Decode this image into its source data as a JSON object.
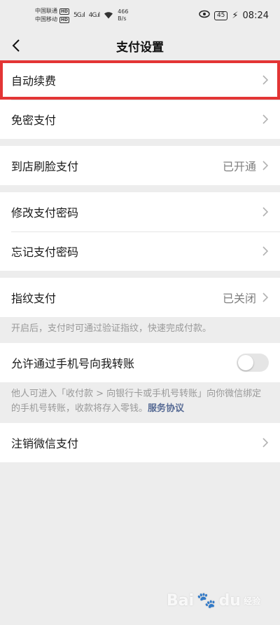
{
  "status_bar": {
    "carrier1": "中国联通",
    "carrier2": "中国移动",
    "hd": "HD",
    "net1": "5G",
    "net2": "4G",
    "speed_value": "466",
    "speed_unit": "B/s",
    "battery": "45",
    "time": "08:24"
  },
  "nav": {
    "title": "支付设置"
  },
  "cells": {
    "auto_renew": "自动续费",
    "password_free": "免密支付",
    "face_pay": {
      "label": "到店刷脸支付",
      "value": "已开通"
    },
    "change_password": "修改支付密码",
    "forgot_password": "忘记支付密码",
    "fingerprint": {
      "label": "指纹支付",
      "value": "已关闭"
    },
    "fingerprint_hint": "开启后，支付时可通过验证指纹，快速完成付款。",
    "phone_transfer": {
      "label": "允许通过手机号向我转账",
      "enabled": false
    },
    "phone_transfer_hint": "他人可进入「收付款 > 向银行卡或手机号转账」向你微信绑定的手机号转账，收款将存入零钱。",
    "service_agreement": "服务协议",
    "cancel_wechat_pay": "注销微信支付"
  },
  "watermark": {
    "brand": "Bai",
    "brand2": "du",
    "sub": "经验"
  },
  "colors": {
    "highlight": "#e33535",
    "link": "#576b95",
    "background": "#ededed"
  }
}
